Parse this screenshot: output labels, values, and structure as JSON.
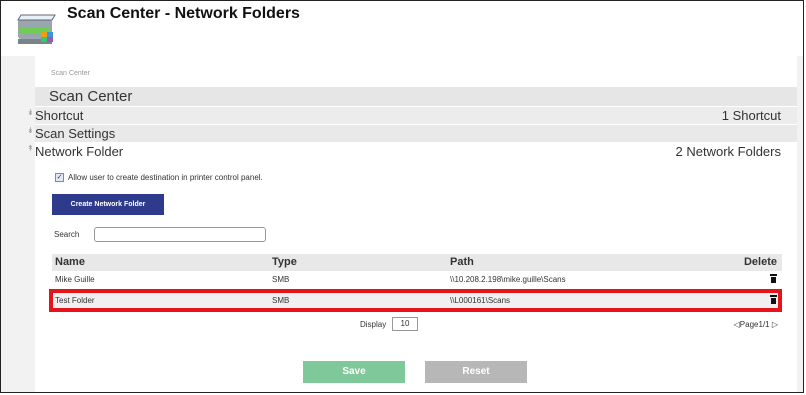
{
  "header": {
    "title": "Scan Center - Network Folders",
    "icon": "scanner-icon"
  },
  "breadcrumb": "Scan Center",
  "section_title": "Scan Center",
  "accordion": [
    {
      "label": "Shortcut",
      "value": "1 Shortcut",
      "icon": "chevron-down-icon"
    },
    {
      "label": "Scan Settings",
      "value": "",
      "icon": "chevron-down-icon"
    },
    {
      "label": "Network Folder",
      "value": "2 Network Folders",
      "icon": "chevron-up-icon"
    }
  ],
  "allow_checkbox": {
    "label": "Allow user to create destination in printer control panel.",
    "checked": true
  },
  "create_button": "Create Network Folder",
  "search": {
    "label": "Search",
    "value": ""
  },
  "table": {
    "columns": [
      "Name",
      "Type",
      "Path",
      "Delete"
    ],
    "rows": [
      {
        "name": "Mike Guille",
        "type": "SMB",
        "path": "\\\\10.208.2.198\\mike.guille\\Scans"
      },
      {
        "name": "Test Folder",
        "type": "SMB",
        "path": "\\\\L000161\\Scans"
      }
    ]
  },
  "display": {
    "label": "Display",
    "value": "10"
  },
  "pager": "◁Page1/1 ▷",
  "buttons": {
    "save": "Save",
    "reset": "Reset"
  },
  "colors": {
    "primary_button": "#2e3a8c",
    "save": "#7fc89a",
    "reset": "#b7b7b7",
    "highlight": "#e6131a"
  }
}
